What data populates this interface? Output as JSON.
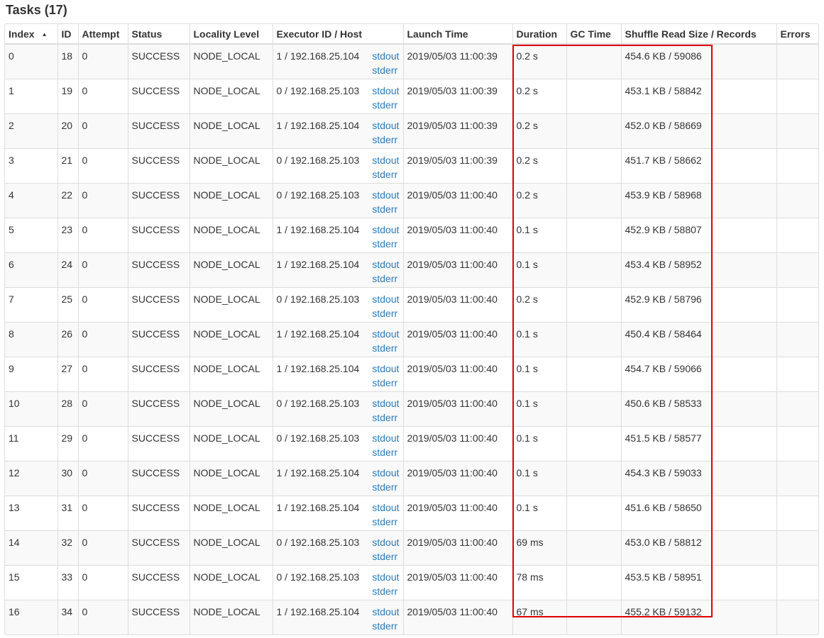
{
  "page": {
    "title": "Tasks (17)"
  },
  "colors": {
    "link": "#2a7ab8",
    "highlight_border": "#e00000",
    "stripe": "#f9f9f9",
    "border": "#dddddd"
  },
  "table": {
    "sort_indicator": "▲",
    "columns": {
      "index": "Index",
      "id": "ID",
      "attempt": "Attempt",
      "status": "Status",
      "locality": "Locality Level",
      "executor": "Executor ID / Host",
      "launch": "Launch Time",
      "duration": "Duration",
      "gc": "GC Time",
      "shuffle": "Shuffle Read Size / Records",
      "errors": "Errors"
    },
    "rows": [
      {
        "index": "0",
        "id": "18",
        "attempt": "0",
        "status": "SUCCESS",
        "locality": "NODE_LOCAL",
        "executor": "1 / 192.168.25.104",
        "stdout": "stdout",
        "stderr": "stderr",
        "launch": "2019/05/03 11:00:39",
        "duration": "0.2 s",
        "gc": "",
        "shuffle": "454.6 KB / 59086",
        "errors": ""
      },
      {
        "index": "1",
        "id": "19",
        "attempt": "0",
        "status": "SUCCESS",
        "locality": "NODE_LOCAL",
        "executor": "0 / 192.168.25.103",
        "stdout": "stdout",
        "stderr": "stderr",
        "launch": "2019/05/03 11:00:39",
        "duration": "0.2 s",
        "gc": "",
        "shuffle": "453.1 KB / 58842",
        "errors": ""
      },
      {
        "index": "2",
        "id": "20",
        "attempt": "0",
        "status": "SUCCESS",
        "locality": "NODE_LOCAL",
        "executor": "1 / 192.168.25.104",
        "stdout": "stdout",
        "stderr": "stderr",
        "launch": "2019/05/03 11:00:39",
        "duration": "0.2 s",
        "gc": "",
        "shuffle": "452.0 KB / 58669",
        "errors": ""
      },
      {
        "index": "3",
        "id": "21",
        "attempt": "0",
        "status": "SUCCESS",
        "locality": "NODE_LOCAL",
        "executor": "0 / 192.168.25.103",
        "stdout": "stdout",
        "stderr": "stderr",
        "launch": "2019/05/03 11:00:39",
        "duration": "0.2 s",
        "gc": "",
        "shuffle": "451.7 KB / 58662",
        "errors": ""
      },
      {
        "index": "4",
        "id": "22",
        "attempt": "0",
        "status": "SUCCESS",
        "locality": "NODE_LOCAL",
        "executor": "0 / 192.168.25.103",
        "stdout": "stdout",
        "stderr": "stderr",
        "launch": "2019/05/03 11:00:40",
        "duration": "0.2 s",
        "gc": "",
        "shuffle": "453.9 KB / 58968",
        "errors": ""
      },
      {
        "index": "5",
        "id": "23",
        "attempt": "0",
        "status": "SUCCESS",
        "locality": "NODE_LOCAL",
        "executor": "1 / 192.168.25.104",
        "stdout": "stdout",
        "stderr": "stderr",
        "launch": "2019/05/03 11:00:40",
        "duration": "0.1 s",
        "gc": "",
        "shuffle": "452.9 KB / 58807",
        "errors": ""
      },
      {
        "index": "6",
        "id": "24",
        "attempt": "0",
        "status": "SUCCESS",
        "locality": "NODE_LOCAL",
        "executor": "1 / 192.168.25.104",
        "stdout": "stdout",
        "stderr": "stderr",
        "launch": "2019/05/03 11:00:40",
        "duration": "0.1 s",
        "gc": "",
        "shuffle": "453.4 KB / 58952",
        "errors": ""
      },
      {
        "index": "7",
        "id": "25",
        "attempt": "0",
        "status": "SUCCESS",
        "locality": "NODE_LOCAL",
        "executor": "0 / 192.168.25.103",
        "stdout": "stdout",
        "stderr": "stderr",
        "launch": "2019/05/03 11:00:40",
        "duration": "0.2 s",
        "gc": "",
        "shuffle": "452.9 KB / 58796",
        "errors": ""
      },
      {
        "index": "8",
        "id": "26",
        "attempt": "0",
        "status": "SUCCESS",
        "locality": "NODE_LOCAL",
        "executor": "1 / 192.168.25.104",
        "stdout": "stdout",
        "stderr": "stderr",
        "launch": "2019/05/03 11:00:40",
        "duration": "0.1 s",
        "gc": "",
        "shuffle": "450.4 KB / 58464",
        "errors": ""
      },
      {
        "index": "9",
        "id": "27",
        "attempt": "0",
        "status": "SUCCESS",
        "locality": "NODE_LOCAL",
        "executor": "1 / 192.168.25.104",
        "stdout": "stdout",
        "stderr": "stderr",
        "launch": "2019/05/03 11:00:40",
        "duration": "0.1 s",
        "gc": "",
        "shuffle": "454.7 KB / 59066",
        "errors": ""
      },
      {
        "index": "10",
        "id": "28",
        "attempt": "0",
        "status": "SUCCESS",
        "locality": "NODE_LOCAL",
        "executor": "0 / 192.168.25.103",
        "stdout": "stdout",
        "stderr": "stderr",
        "launch": "2019/05/03 11:00:40",
        "duration": "0.1 s",
        "gc": "",
        "shuffle": "450.6 KB / 58533",
        "errors": ""
      },
      {
        "index": "11",
        "id": "29",
        "attempt": "0",
        "status": "SUCCESS",
        "locality": "NODE_LOCAL",
        "executor": "0 / 192.168.25.103",
        "stdout": "stdout",
        "stderr": "stderr",
        "launch": "2019/05/03 11:00:40",
        "duration": "0.1 s",
        "gc": "",
        "shuffle": "451.5 KB / 58577",
        "errors": ""
      },
      {
        "index": "12",
        "id": "30",
        "attempt": "0",
        "status": "SUCCESS",
        "locality": "NODE_LOCAL",
        "executor": "1 / 192.168.25.104",
        "stdout": "stdout",
        "stderr": "stderr",
        "launch": "2019/05/03 11:00:40",
        "duration": "0.1 s",
        "gc": "",
        "shuffle": "454.3 KB / 59033",
        "errors": ""
      },
      {
        "index": "13",
        "id": "31",
        "attempt": "0",
        "status": "SUCCESS",
        "locality": "NODE_LOCAL",
        "executor": "1 / 192.168.25.104",
        "stdout": "stdout",
        "stderr": "stderr",
        "launch": "2019/05/03 11:00:40",
        "duration": "0.1 s",
        "gc": "",
        "shuffle": "451.6 KB / 58650",
        "errors": ""
      },
      {
        "index": "14",
        "id": "32",
        "attempt": "0",
        "status": "SUCCESS",
        "locality": "NODE_LOCAL",
        "executor": "0 / 192.168.25.103",
        "stdout": "stdout",
        "stderr": "stderr",
        "launch": "2019/05/03 11:00:40",
        "duration": "69 ms",
        "gc": "",
        "shuffle": "453.0 KB / 58812",
        "errors": ""
      },
      {
        "index": "15",
        "id": "33",
        "attempt": "0",
        "status": "SUCCESS",
        "locality": "NODE_LOCAL",
        "executor": "0 / 192.168.25.103",
        "stdout": "stdout",
        "stderr": "stderr",
        "launch": "2019/05/03 11:00:40",
        "duration": "78 ms",
        "gc": "",
        "shuffle": "453.5 KB / 58951",
        "errors": ""
      },
      {
        "index": "16",
        "id": "34",
        "attempt": "0",
        "status": "SUCCESS",
        "locality": "NODE_LOCAL",
        "executor": "1 / 192.168.25.104",
        "stdout": "stdout",
        "stderr": "stderr",
        "launch": "2019/05/03 11:00:40",
        "duration": "67 ms",
        "gc": "",
        "shuffle": "455.2 KB / 59132",
        "errors": ""
      }
    ]
  }
}
